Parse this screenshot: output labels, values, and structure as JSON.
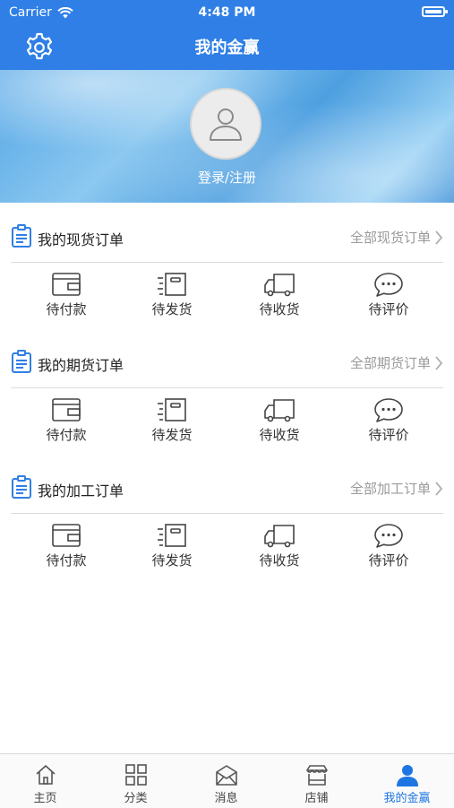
{
  "status": {
    "carrier": "Carrier",
    "time": "4:48 PM"
  },
  "header": {
    "title": "我的金赢",
    "settings_icon": "gear-icon"
  },
  "profile": {
    "login_text": "登录/注册",
    "avatar_icon": "user-icon"
  },
  "sections": [
    {
      "title": "我的现货订单",
      "link": "全部现货订单"
    },
    {
      "title": "我的期货订单",
      "link": "全部期货订单"
    },
    {
      "title": "我的加工订单",
      "link": "全部加工订单"
    }
  ],
  "order_items": [
    {
      "label": "待付款",
      "icon": "wallet-icon"
    },
    {
      "label": "待发货",
      "icon": "package-icon"
    },
    {
      "label": "待收货",
      "icon": "truck-icon"
    },
    {
      "label": "待评价",
      "icon": "chat-icon"
    }
  ],
  "tabs": [
    {
      "label": "主页",
      "icon": "home-icon",
      "active": false
    },
    {
      "label": "分类",
      "icon": "grid-icon",
      "active": false
    },
    {
      "label": "消息",
      "icon": "mail-icon",
      "active": false
    },
    {
      "label": "店铺",
      "icon": "shop-icon",
      "active": false
    },
    {
      "label": "我的金赢",
      "icon": "person-icon",
      "active": true
    }
  ],
  "colors": {
    "primary": "#2f7fe6",
    "tab_active": "#1e76e2",
    "muted": "#9a9a9a"
  }
}
